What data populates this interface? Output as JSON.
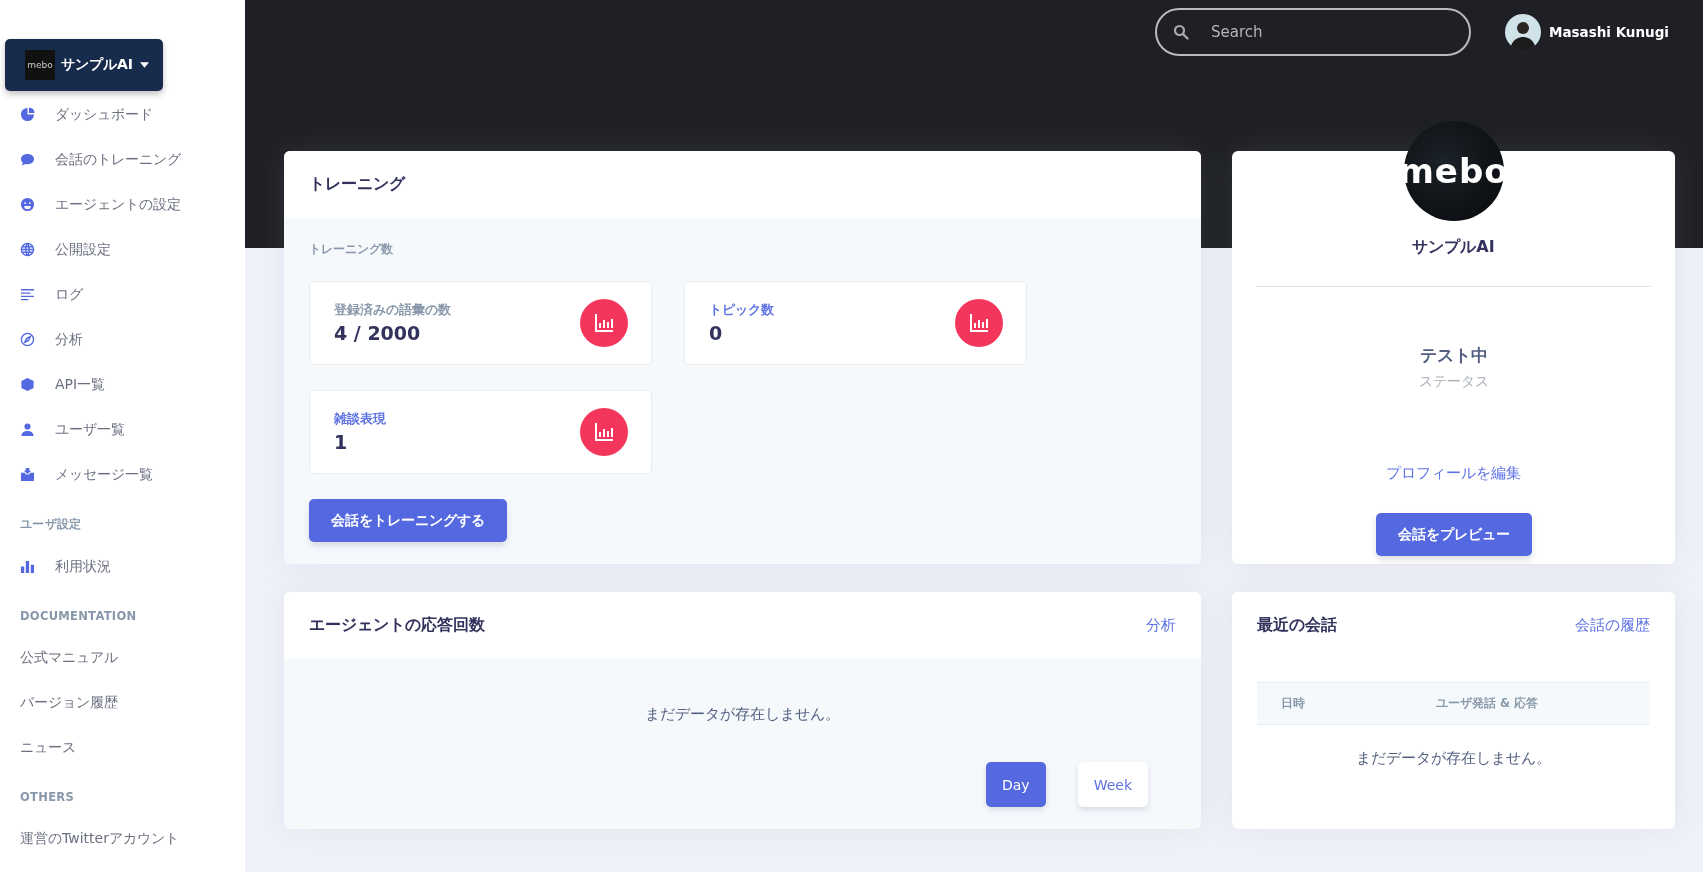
{
  "brand": {
    "logo_text": "mebo",
    "name": "サンプルAI"
  },
  "sidebar": {
    "items": [
      {
        "label": "ダッシュボード",
        "kind": "pie"
      },
      {
        "label": "会話のトレーニング",
        "kind": "chat"
      },
      {
        "label": "エージェントの設定",
        "kind": "smile"
      },
      {
        "label": "公開設定",
        "kind": "globe"
      },
      {
        "label": "ログ",
        "kind": "lines"
      },
      {
        "label": "分析",
        "kind": "compass"
      },
      {
        "label": "API一覧",
        "kind": "cube"
      },
      {
        "label": "ユーザ一覧",
        "kind": "user"
      },
      {
        "label": "メッセージ一覧",
        "kind": "box"
      }
    ],
    "sections": [
      {
        "heading": "ユーザ設定",
        "items": [
          {
            "label": "利用状況",
            "kind": "bars"
          }
        ]
      },
      {
        "heading": "DOCUMENTATION",
        "items": [
          {
            "label": "公式マニュアル",
            "kind": "text"
          },
          {
            "label": "バージョン履歴",
            "kind": "text"
          },
          {
            "label": "ニュース",
            "kind": "text"
          }
        ]
      },
      {
        "heading": "OTHERS",
        "items": [
          {
            "label": "運営のTwitterアカウント",
            "kind": "text"
          }
        ]
      }
    ]
  },
  "search": {
    "placeholder": "Search"
  },
  "user": {
    "name": "Masashi Kunugi"
  },
  "training": {
    "title": "トレーニング",
    "subtitle": "トレーニング数",
    "stats": [
      {
        "label": "登録済みの語彙の数",
        "value": "4 / 2000",
        "kind": "plain"
      },
      {
        "label": "トピック数",
        "value": "0",
        "kind": "link"
      },
      {
        "label": "雑談表現",
        "value": "1",
        "kind": "link"
      }
    ],
    "button": "会話をトレーニングする"
  },
  "profile": {
    "logo_text": "mebo",
    "name": "サンプルAI",
    "status": "テスト中",
    "status_label": "ステータス",
    "edit_link": "プロフィールを編集",
    "button": "会話をプレビュー"
  },
  "responses": {
    "title": "エージェントの応答回数",
    "link": "分析",
    "empty": "まだデータが存在しません。",
    "tabs": [
      {
        "label": "Day",
        "selected": true
      },
      {
        "label": "Week",
        "selected": false
      }
    ]
  },
  "recent": {
    "title": "最近の会話",
    "link": "会話の履歴",
    "columns": [
      "日時",
      "ユーザ発話 & 応答"
    ],
    "empty": "まだデータが存在しません。"
  }
}
